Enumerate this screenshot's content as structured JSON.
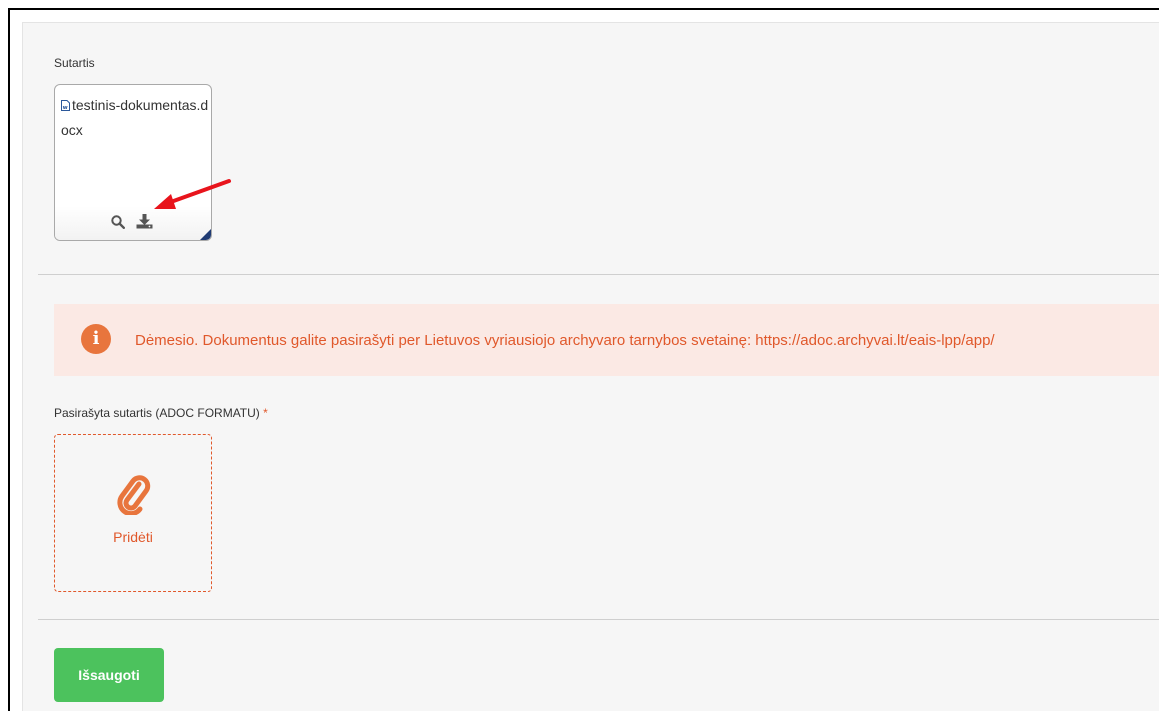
{
  "contract": {
    "label": "Sutartis",
    "file_name": "testinis-dokumentas.docx",
    "preview_icon": "search-icon",
    "download_icon": "download-icon"
  },
  "notice": {
    "icon": "info-icon",
    "text": "Dėmesio. Dokumentus galite pasirašyti per Lietuvos vyriausiojo archyvaro tarnybos svetainę: https://adoc.archyvai.lt/eais-lpp/app/"
  },
  "signed_contract": {
    "label": "Pasirašyta sutartis (ADOC FORMATU)",
    "required_mark": "*",
    "upload_label": "Pridėti",
    "upload_icon": "paperclip-icon"
  },
  "actions": {
    "save_label": "Išsaugoti"
  },
  "colors": {
    "accent_orange": "#e0582b",
    "notice_bg": "#fbe9e4",
    "save_green": "#4cc25d",
    "annotation_arrow": "#e8141c"
  }
}
